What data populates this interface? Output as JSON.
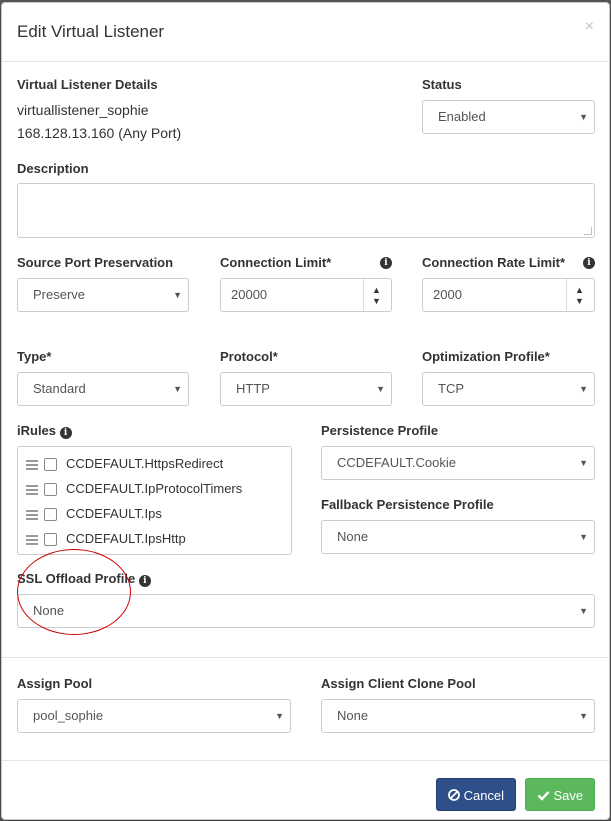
{
  "modal": {
    "title": "Edit Virtual Listener",
    "close_glyph": "×"
  },
  "details": {
    "label": "Virtual Listener Details",
    "name": "virtuallistener_sophie",
    "address": "168.128.13.160 (Any Port)"
  },
  "status": {
    "label": "Status",
    "value": "Enabled"
  },
  "description": {
    "label": "Description",
    "value": ""
  },
  "source_port": {
    "label": "Source Port Preservation",
    "value": "Preserve"
  },
  "connection_limit": {
    "label": "Connection Limit*",
    "value": "20000"
  },
  "connection_rate_limit": {
    "label": "Connection Rate Limit*",
    "value": "2000"
  },
  "type": {
    "label": "Type*",
    "value": "Standard"
  },
  "protocol": {
    "label": "Protocol*",
    "value": "HTTP"
  },
  "optimization_profile": {
    "label": "Optimization Profile*",
    "value": "TCP"
  },
  "irules": {
    "label": "iRules",
    "items": [
      {
        "label": "CCDEFAULT.HttpsRedirect",
        "checked": false
      },
      {
        "label": "CCDEFAULT.IpProtocolTimers",
        "checked": false
      },
      {
        "label": "CCDEFAULT.Ips",
        "checked": false
      },
      {
        "label": "CCDEFAULT.IpsHttp",
        "checked": false
      }
    ]
  },
  "persistence_profile": {
    "label": "Persistence Profile",
    "value": "CCDEFAULT.Cookie"
  },
  "fallback_persistence_profile": {
    "label": "Fallback Persistence Profile",
    "value": "None"
  },
  "ssl_offload_profile": {
    "label": "SSL Offload Profile",
    "value": "None"
  },
  "assign_pool": {
    "label": "Assign Pool",
    "value": "pool_sophie"
  },
  "assign_client_clone_pool": {
    "label": "Assign Client Clone Pool",
    "value": "None"
  },
  "footer": {
    "cancel_label": "Cancel",
    "save_label": "Save"
  },
  "icons": {
    "select_caret": "▼",
    "spin_up": "▲",
    "spin_down": "▼",
    "info": "i"
  },
  "colors": {
    "cancel": "#2f4f8a",
    "save": "#5cb85c",
    "annotation": "#cc0000"
  }
}
